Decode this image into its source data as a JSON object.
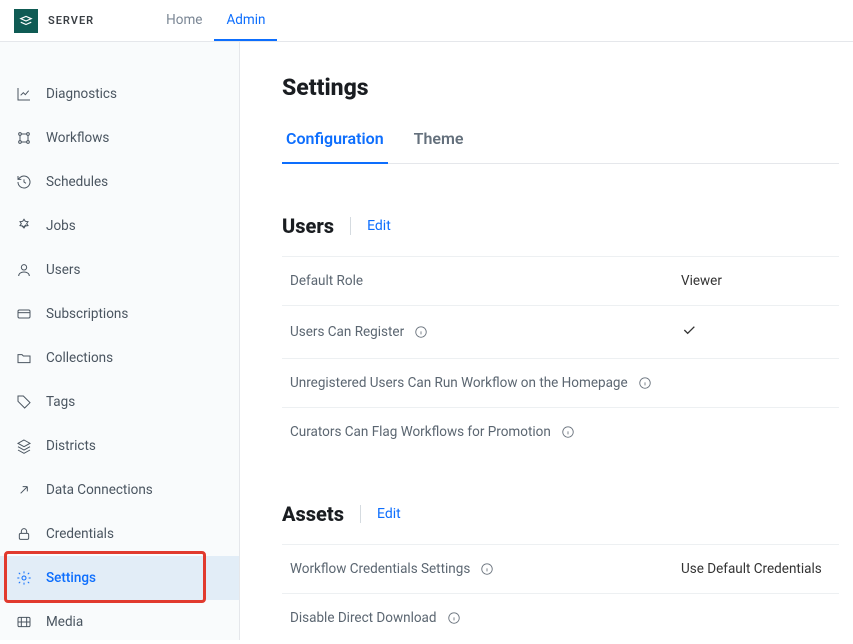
{
  "header": {
    "logo_text": "SERVER",
    "nav": {
      "home": "Home",
      "admin": "Admin"
    }
  },
  "sidebar": {
    "items": [
      {
        "label": "Diagnostics"
      },
      {
        "label": "Workflows"
      },
      {
        "label": "Schedules"
      },
      {
        "label": "Jobs"
      },
      {
        "label": "Users"
      },
      {
        "label": "Subscriptions"
      },
      {
        "label": "Collections"
      },
      {
        "label": "Tags"
      },
      {
        "label": "Districts"
      },
      {
        "label": "Data Connections"
      },
      {
        "label": "Credentials"
      },
      {
        "label": "Settings"
      },
      {
        "label": "Media"
      }
    ]
  },
  "page": {
    "title": "Settings",
    "tabs": {
      "configuration": "Configuration",
      "theme": "Theme"
    },
    "sections": {
      "users": {
        "title": "Users",
        "edit": "Edit",
        "rows": {
          "default_role": {
            "label": "Default Role",
            "value": "Viewer"
          },
          "can_register": {
            "label": "Users Can Register"
          },
          "unreg_run": {
            "label": "Unregistered Users Can Run Workflow on the Homepage"
          },
          "curators_flag": {
            "label": "Curators Can Flag Workflows for Promotion"
          }
        }
      },
      "assets": {
        "title": "Assets",
        "edit": "Edit",
        "rows": {
          "wf_creds": {
            "label": "Workflow Credentials Settings",
            "value": "Use Default Credentials"
          },
          "disable_dd": {
            "label": "Disable Direct Download"
          }
        }
      }
    }
  }
}
